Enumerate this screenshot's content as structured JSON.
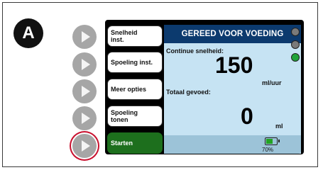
{
  "badge": {
    "label": "A"
  },
  "menu": {
    "items": [
      {
        "label_line1": "Snelheid",
        "label_line2": "inst."
      },
      {
        "label": "Spoeling inst."
      },
      {
        "label": "Meer opties"
      },
      {
        "label_line1": "Spoeling",
        "label_line2": "tonen"
      },
      {
        "label": "Starten"
      }
    ]
  },
  "status": {
    "header": "GEREED VOOR VOEDING"
  },
  "rate": {
    "label": "Continue snelheid:",
    "value": "150",
    "unit": "ml/uur"
  },
  "total": {
    "label": "Totaal gevoed:",
    "value": "0",
    "unit": "ml"
  },
  "battery": {
    "percent_label": "70%",
    "level": 0.7
  },
  "indicators": {
    "colors": [
      "#7a7a7a",
      "#7a7a7a",
      "#1fa33a"
    ]
  }
}
